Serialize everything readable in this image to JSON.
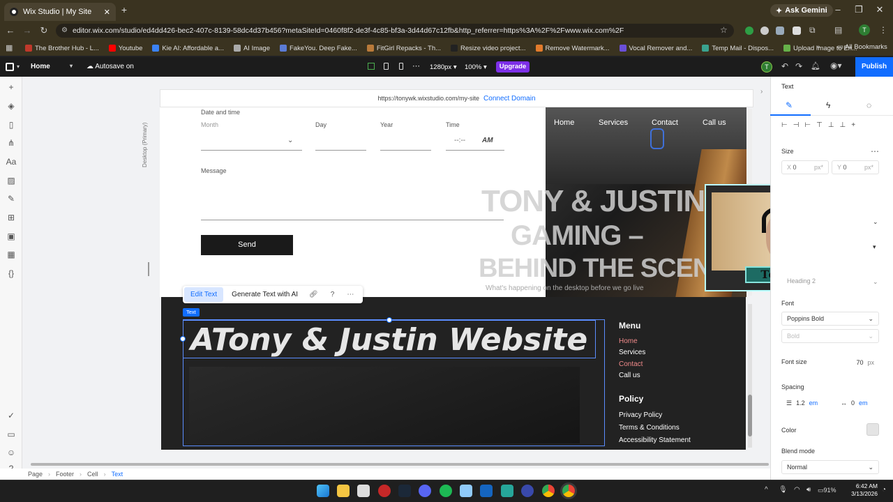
{
  "browser": {
    "tab_title": "Wix Studio | My Site",
    "ask_gemini": "Ask Gemini",
    "url": "editor.wix.com/studio/ed4dd426-bec2-407c-8139-58dc4d37b456?metaSiteId=0460f8f2-de3f-4c85-bf3a-3d44d67c12fb&http_referrer=https%3A%2F%2Fwww.wix.com%2F",
    "bookmarks": [
      {
        "label": "The Brother Hub - L...",
        "color": "#c0392b"
      },
      {
        "label": "Youtube",
        "color": "#ff0000"
      },
      {
        "label": "Kie AI: Affordable a...",
        "color": "#3b82f6"
      },
      {
        "label": "AI Image",
        "color": "#aaaaaa"
      },
      {
        "label": "FakeYou. Deep Fake...",
        "color": "#5b7bd5"
      },
      {
        "label": "FitGirl Repacks - Th...",
        "color": "#b97a3a"
      },
      {
        "label": "Resize video project...",
        "color": "#222222"
      },
      {
        "label": "Remove Watermark...",
        "color": "#e27b2c"
      },
      {
        "label": "Vocal Remover and...",
        "color": "#6a4fd8"
      },
      {
        "label": "Temp Mail - Dispos...",
        "color": "#3aa38f"
      },
      {
        "label": "Upload Image to En...",
        "color": "#66b14a"
      }
    ],
    "all_bookmarks": "All Bookmarks",
    "profile_initial": "T"
  },
  "wix_toolbar": {
    "page_selector": "Home",
    "autosave": "Autosave on",
    "breakpoint": "1280px",
    "zoom": "100%",
    "upgrade": "Upgrade",
    "publish": "Publish",
    "user_initial": "T"
  },
  "canvas": {
    "site_url": "https://tonywk.wixstudio.com/my-site",
    "connect_domain": "Connect Domain",
    "desktop_label": "Desktop (Primary)",
    "form": {
      "date_time_label": "Date and time",
      "month_placeholder": "Month",
      "day_label": "Day",
      "year_label": "Year",
      "time_label": "Time",
      "time_value": "--:--",
      "ampm": "AM",
      "message_label": "Message",
      "send": "Send"
    },
    "hero": {
      "nav": [
        "Home",
        "Services",
        "Contact",
        "Call us"
      ],
      "title_line1": "TONY & JUSTIN",
      "title_line2": "GAMING –",
      "title_line3": "BEHIND THE SCENES",
      "subtitle": "What's happening on the desktop before we go live"
    },
    "context_menu": {
      "edit_text": "Edit Text",
      "generate": "Generate Text with AI"
    },
    "text_tag": "Text",
    "footer": {
      "big_text": "ATony & Justin Website",
      "menu_heading": "Menu",
      "menu_items": [
        "Home",
        "Services",
        "Contact",
        "Call us"
      ],
      "policy_heading": "Policy",
      "policy_items": [
        "Privacy Policy",
        "Terms & Conditions",
        "Accessibility Statement"
      ]
    },
    "webcam_label": "Tony K"
  },
  "right_panel": {
    "heading": "Text",
    "size_label": "Size",
    "x_value": "0",
    "y_value": "0",
    "px_unit": "px*",
    "heading_style": "Heading 2",
    "font_label": "Font",
    "font_value": "Poppins Bold",
    "font_weight": "Bold",
    "font_size_label": "Font size",
    "font_size_value": "70",
    "font_size_unit": "px",
    "spacing_label": "Spacing",
    "line_spacing": "1.2",
    "em_unit": "em",
    "letter_spacing": "0",
    "color_label": "Color",
    "blend_label": "Blend mode",
    "blend_value": "Normal"
  },
  "breadcrumbs": [
    "Page",
    "Footer",
    "Cell",
    "Text"
  ],
  "taskbar": {
    "battery": "91%",
    "time": "6:42 AM",
    "date": "3/13/2026"
  }
}
